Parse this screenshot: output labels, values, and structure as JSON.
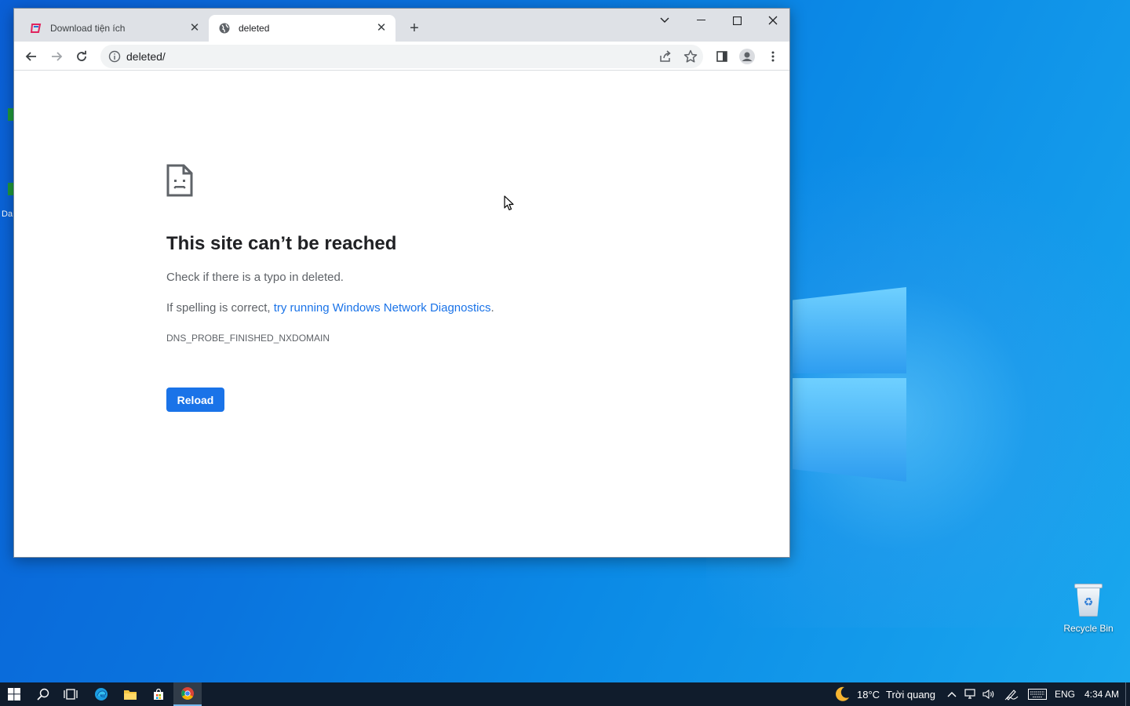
{
  "browser": {
    "tabs": [
      {
        "title": "Download tiện ích",
        "favicon": "store-favicon",
        "active": false
      },
      {
        "title": "deleted",
        "favicon": "globe-favicon",
        "active": true
      }
    ],
    "new_tab_label": "+",
    "address": "deleted/"
  },
  "error_page": {
    "title": "This site can’t be reached",
    "line1": "Check if there is a typo in deleted.",
    "line2_prefix": "If spelling is correct,",
    "line2_link": "try running Windows Network Diagnostics",
    "line2_suffix": ".",
    "code": "DNS_PROBE_FINISHED_NXDOMAIN",
    "reload_label": "Reload"
  },
  "desktop": {
    "left_icon_partial_label": "Da",
    "recycle_bin_label": "Recycle Bin"
  },
  "taskbar": {
    "weather_temp": "18°C",
    "weather_text": "Trời quang",
    "language": "ENG",
    "time": "4:34 AM"
  },
  "colors": {
    "accent": "#1a73e8",
    "tabstrip": "#dee1e6",
    "taskbar": "#101c2c"
  }
}
